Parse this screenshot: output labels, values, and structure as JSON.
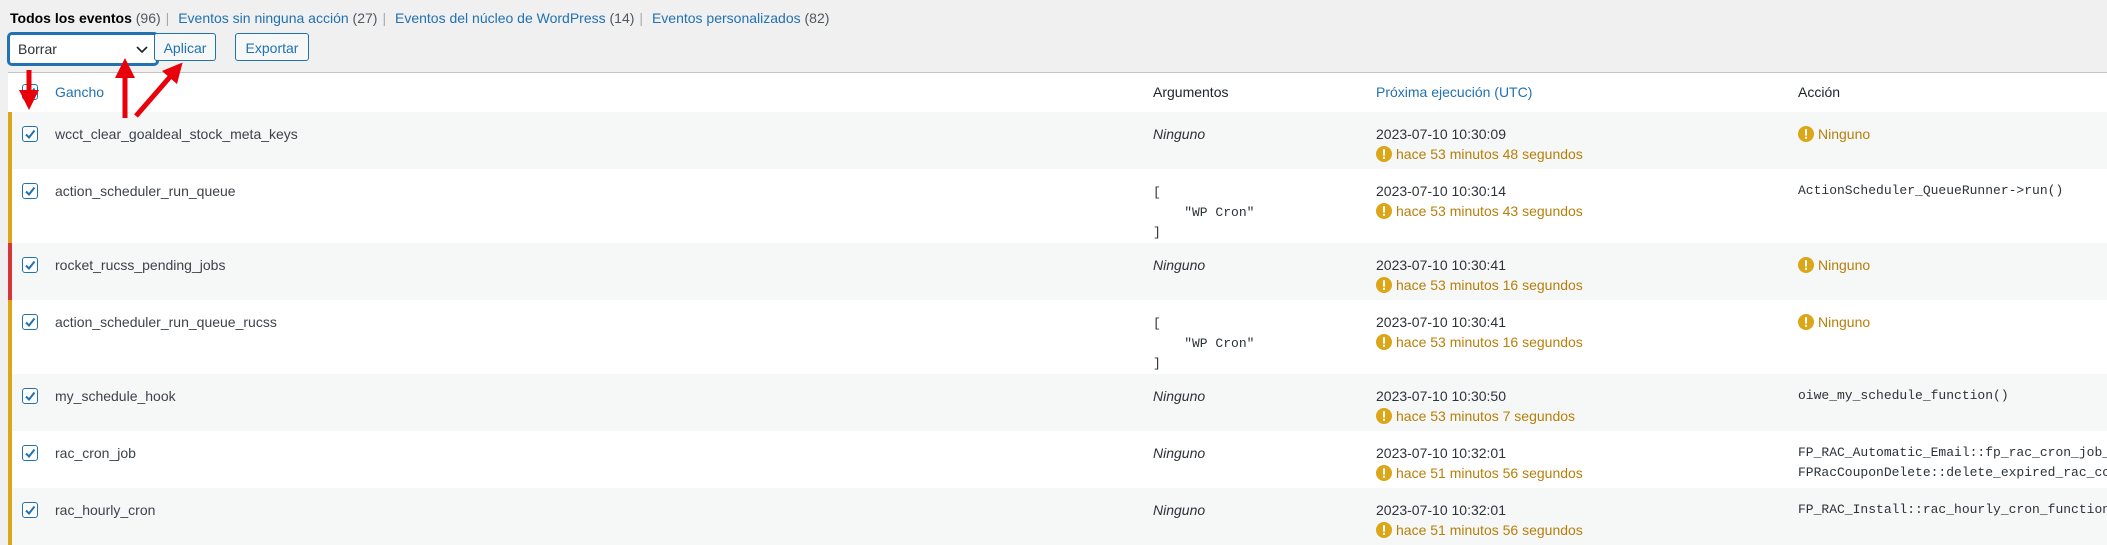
{
  "views": [
    {
      "label": "Todos los eventos",
      "count": "(96)",
      "current": true
    },
    {
      "label": "Eventos sin ninguna acción",
      "count": "(27)",
      "current": false
    },
    {
      "label": "Eventos del núcleo de WordPress",
      "count": "(14)",
      "current": false
    },
    {
      "label": "Eventos personalizados",
      "count": "(82)",
      "current": false
    }
  ],
  "toolbar": {
    "bulk_selected": "Borrar",
    "apply_label": "Aplicar",
    "export_label": "Exportar"
  },
  "table": {
    "headers": {
      "hook": "Gancho",
      "args": "Argumentos",
      "next": "Próxima ejecución (UTC)",
      "action": "Acción"
    },
    "rows": [
      {
        "hook": "wcct_clear_goaldeal_stock_meta_keys",
        "args": "Ninguno",
        "args_mono": false,
        "date": "2023-07-10 10:30:09",
        "relative": "hace 53 minutos 48 segundos",
        "action": [
          "Ninguno"
        ],
        "action_warn": true,
        "bar": "#dba617",
        "checked": true
      },
      {
        "hook": "action_scheduler_run_queue",
        "args": "[\n    \"WP Cron\"\n]",
        "args_mono": true,
        "date": "2023-07-10 10:30:14",
        "relative": "hace 53 minutos 43 segundos",
        "action": [
          "ActionScheduler_QueueRunner->run()"
        ],
        "action_warn": false,
        "bar": "#dba617",
        "checked": true
      },
      {
        "hook": "rocket_rucss_pending_jobs",
        "args": "Ninguno",
        "args_mono": false,
        "date": "2023-07-10 10:30:41",
        "relative": "hace 53 minutos 16 segundos",
        "action": [
          "Ninguno"
        ],
        "action_warn": true,
        "bar": "#d63638",
        "checked": true
      },
      {
        "hook": "action_scheduler_run_queue_rucss",
        "args": "[\n    \"WP Cron\"\n]",
        "args_mono": true,
        "date": "2023-07-10 10:30:41",
        "relative": "hace 53 minutos 16 segundos",
        "action": [
          "Ninguno"
        ],
        "action_warn": true,
        "bar": "#dba617",
        "checked": true
      },
      {
        "hook": "my_schedule_hook",
        "args": "Ninguno",
        "args_mono": false,
        "date": "2023-07-10 10:30:50",
        "relative": "hace 53 minutos 7 segundos",
        "action": [
          "oiwe_my_schedule_function()"
        ],
        "action_warn": false,
        "bar": "#dba617",
        "checked": true
      },
      {
        "hook": "rac_cron_job",
        "args": "Ninguno",
        "args_mono": false,
        "date": "2023-07-10 10:32:01",
        "relative": "hace 51 minutos 56 segundos",
        "action": [
          "FP_RAC_Automatic_Email::fp_rac_cron_job_mai",
          "FPRacCouponDelete::delete_expired_rac_coupo"
        ],
        "action_warn": false,
        "bar": "#dba617",
        "checked": true
      },
      {
        "hook": "rac_hourly_cron",
        "args": "Ninguno",
        "args_mono": false,
        "date": "2023-07-10 10:32:01",
        "relative": "hace 51 minutos 56 segundos",
        "action": [
          "FP_RAC_Install::rac_hourly_cron_functions()"
        ],
        "action_warn": false,
        "bar": "#dba617",
        "checked": true
      }
    ]
  },
  "colors": {
    "link": "#2271b1",
    "warning": "#b77f0a",
    "annotation_arrow": "#e8000b"
  }
}
